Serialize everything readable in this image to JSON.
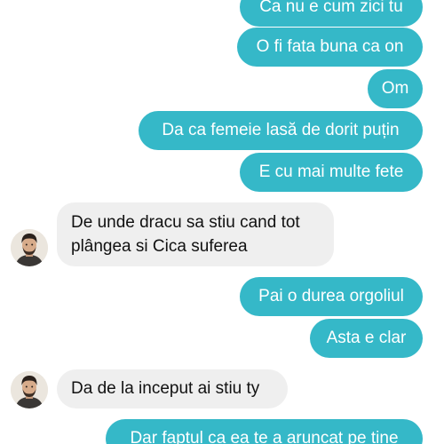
{
  "colors": {
    "outgoing_bubble": "#35b8c8",
    "incoming_bubble": "#efefef",
    "outgoing_text": "#ffffff",
    "incoming_text": "#111111"
  },
  "messages": [
    {
      "direction": "outgoing",
      "text": "Ca nu e cum zici tu"
    },
    {
      "direction": "outgoing",
      "text": "O fi fata buna ca on"
    },
    {
      "direction": "outgoing",
      "text": "Om"
    },
    {
      "direction": "outgoing",
      "text": "Da ca femeie lasă de dorit puțin"
    },
    {
      "direction": "outgoing",
      "text": "E cu mai multe fete"
    },
    {
      "direction": "incoming",
      "lines": [
        "De unde dracu sa stiu cand tot",
        "plângea si Cica suferea"
      ],
      "avatar": "contact-avatar"
    },
    {
      "direction": "outgoing",
      "text": "Pai o durea orgoliul"
    },
    {
      "direction": "outgoing",
      "text": "Asta e clar"
    },
    {
      "direction": "incoming",
      "text": "Da de la inceput ai stiu ty",
      "avatar": "contact-avatar"
    },
    {
      "direction": "outgoing",
      "text": "Dar faptul ca ea te a aruncat pe tine"
    }
  ]
}
